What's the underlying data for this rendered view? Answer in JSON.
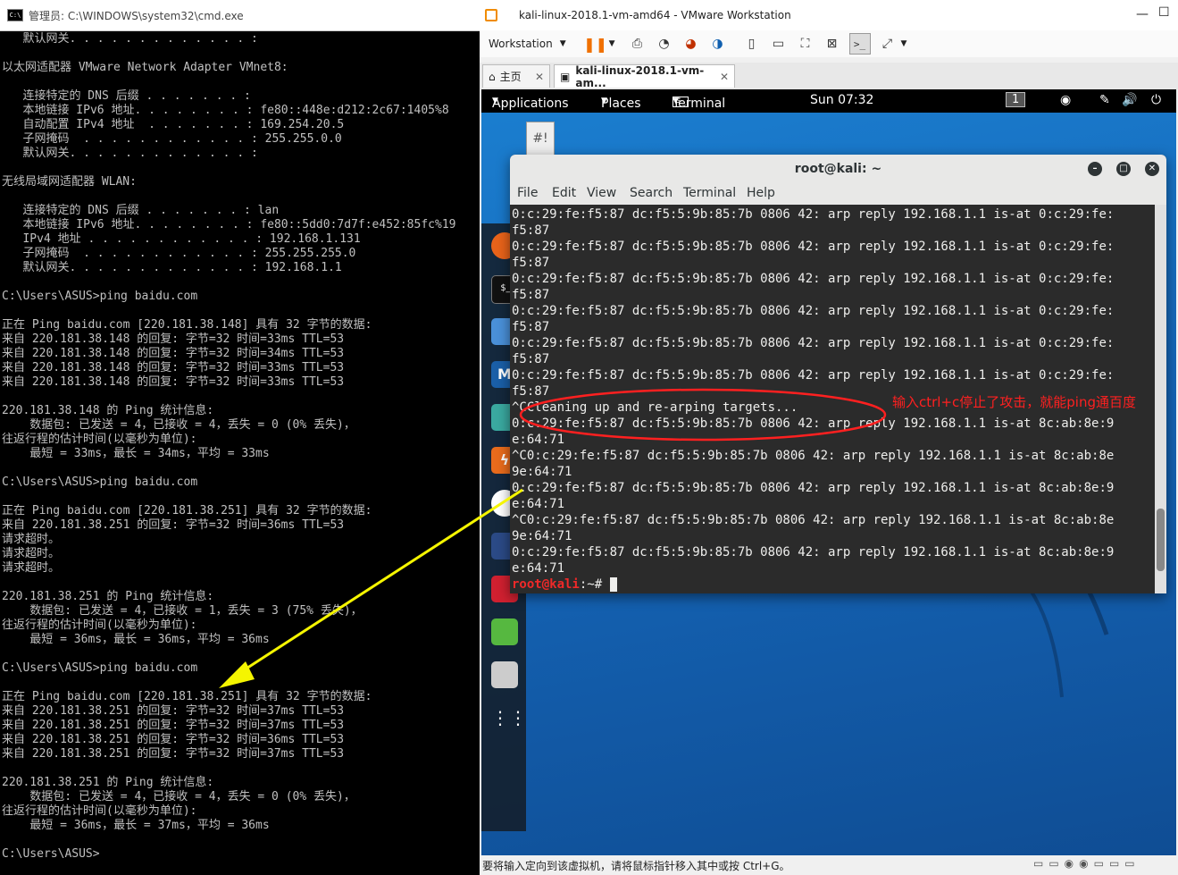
{
  "cmd": {
    "title": "管理员: C:\\WINDOWS\\system32\\cmd.exe",
    "icon": "console-icon",
    "lines": [
      "   默认网关. . . . . . . . . . . . . :",
      "",
      "以太网适配器 VMware Network Adapter VMnet8:",
      "",
      "   连接特定的 DNS 后缀 . . . . . . . :",
      "   本地链接 IPv6 地址. . . . . . . . : fe80::448e:d212:2c67:1405%8",
      "   自动配置 IPv4 地址  . . . . . . . : 169.254.20.5",
      "   子网掩码  . . . . . . . . . . . . : 255.255.0.0",
      "   默认网关. . . . . . . . . . . . . :",
      "",
      "无线局域网适配器 WLAN:",
      "",
      "   连接特定的 DNS 后缀 . . . . . . . : lan",
      "   本地链接 IPv6 地址. . . . . . . . : fe80::5dd0:7d7f:e452:85fc%19",
      "   IPv4 地址 . . . . . . . . . . . . : 192.168.1.131",
      "   子网掩码  . . . . . . . . . . . . : 255.255.255.0",
      "   默认网关. . . . . . . . . . . . . : 192.168.1.1",
      "",
      "C:\\Users\\ASUS>ping baidu.com",
      "",
      "正在 Ping baidu.com [220.181.38.148] 具有 32 字节的数据:",
      "来自 220.181.38.148 的回复: 字节=32 时间=33ms TTL=53",
      "来自 220.181.38.148 的回复: 字节=32 时间=34ms TTL=53",
      "来自 220.181.38.148 的回复: 字节=32 时间=33ms TTL=53",
      "来自 220.181.38.148 的回复: 字节=32 时间=33ms TTL=53",
      "",
      "220.181.38.148 的 Ping 统计信息:",
      "    数据包: 已发送 = 4，已接收 = 4，丢失 = 0 (0% 丢失)，",
      "往返行程的估计时间(以毫秒为单位):",
      "    最短 = 33ms，最长 = 34ms，平均 = 33ms",
      "",
      "C:\\Users\\ASUS>ping baidu.com",
      "",
      "正在 Ping baidu.com [220.181.38.251] 具有 32 字节的数据:",
      "来自 220.181.38.251 的回复: 字节=32 时间=36ms TTL=53",
      "请求超时。",
      "请求超时。",
      "请求超时。",
      "",
      "220.181.38.251 的 Ping 统计信息:",
      "    数据包: 已发送 = 4，已接收 = 1，丢失 = 3 (75% 丢失)，",
      "往返行程的估计时间(以毫秒为单位):",
      "    最短 = 36ms，最长 = 36ms，平均 = 36ms",
      "",
      "C:\\Users\\ASUS>ping baidu.com",
      "",
      "正在 Ping baidu.com [220.181.38.251] 具有 32 字节的数据:",
      "来自 220.181.38.251 的回复: 字节=32 时间=37ms TTL=53",
      "来自 220.181.38.251 的回复: 字节=32 时间=37ms TTL=53",
      "来自 220.181.38.251 的回复: 字节=32 时间=36ms TTL=53",
      "来自 220.181.38.251 的回复: 字节=32 时间=37ms TTL=53",
      "",
      "220.181.38.251 的 Ping 统计信息:",
      "    数据包: 已发送 = 4，已接收 = 4，丢失 = 0 (0% 丢失)，",
      "往返行程的估计时间(以毫秒为单位):",
      "    最短 = 36ms，最长 = 37ms，平均 = 36ms",
      "",
      "C:\\Users\\ASUS>"
    ]
  },
  "vmware": {
    "title": "kali-linux-2018.1-vm-amd64 - VMware Workstation",
    "menu_label": "Workstation",
    "tabs": [
      {
        "label": "主页",
        "icon": "home-icon"
      },
      {
        "label": "kali-linux-2018.1-vm-am...",
        "icon": "vm-icon"
      }
    ],
    "status_text": "要将输入定向到该虚拟机，请将鼠标指针移入其中或按 Ctrl+G。"
  },
  "kali": {
    "topbar": {
      "applications": "Applications",
      "places": "Places",
      "terminal": "Terminal",
      "clock": "Sun 07:32",
      "workspace": "1"
    },
    "dock_tooltip": "burpsuite",
    "desktop_icon_label": "#!"
  },
  "terminal": {
    "title": "root@kali: ~",
    "menu": [
      "File",
      "Edit",
      "View",
      "Search",
      "Terminal",
      "Help"
    ],
    "lines": [
      "0:c:29:fe:f5:87 dc:f5:5:9b:85:7b 0806 42: arp reply 192.168.1.1 is-at 0:c:29:fe:",
      "f5:87",
      "0:c:29:fe:f5:87 dc:f5:5:9b:85:7b 0806 42: arp reply 192.168.1.1 is-at 0:c:29:fe:",
      "f5:87",
      "0:c:29:fe:f5:87 dc:f5:5:9b:85:7b 0806 42: arp reply 192.168.1.1 is-at 0:c:29:fe:",
      "f5:87",
      "0:c:29:fe:f5:87 dc:f5:5:9b:85:7b 0806 42: arp reply 192.168.1.1 is-at 0:c:29:fe:",
      "f5:87",
      "0:c:29:fe:f5:87 dc:f5:5:9b:85:7b 0806 42: arp reply 192.168.1.1 is-at 0:c:29:fe:",
      "f5:87",
      "0:c:29:fe:f5:87 dc:f5:5:9b:85:7b 0806 42: arp reply 192.168.1.1 is-at 0:c:29:fe:",
      "f5:87",
      "^CCleaning up and re-arping targets...",
      "0:c:29:fe:f5:87 dc:f5:5:9b:85:7b 0806 42: arp reply 192.168.1.1 is-at 8c:ab:8e:9",
      "e:64:71",
      "^C0:c:29:fe:f5:87 dc:f5:5:9b:85:7b 0806 42: arp reply 192.168.1.1 is-at 8c:ab:8e",
      "9e:64:71",
      "0:c:29:fe:f5:87 dc:f5:5:9b:85:7b 0806 42: arp reply 192.168.1.1 is-at 8c:ab:8e:9",
      "e:64:71",
      "^C0:c:29:fe:f5:87 dc:f5:5:9b:85:7b 0806 42: arp reply 192.168.1.1 is-at 8c:ab:8e",
      "9e:64:71",
      "0:c:29:fe:f5:87 dc:f5:5:9b:85:7b 0806 42: arp reply 192.168.1.1 is-at 8c:ab:8e:9",
      "e:64:71"
    ],
    "prompt_user": "root@kali",
    "prompt_path": ":~# "
  },
  "annotation": {
    "text": "输入ctrl+c停止了攻击，就能ping通百度",
    "color": "#ff2020",
    "arrow_color": "#f5f500"
  }
}
